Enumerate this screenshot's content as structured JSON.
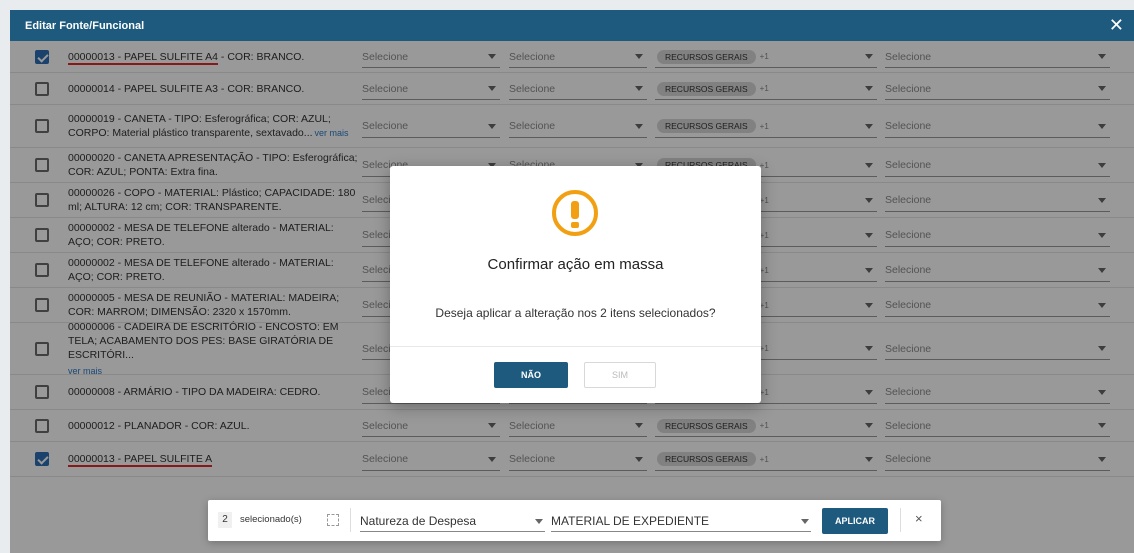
{
  "window": {
    "title": "Editar Fonte/Funcional",
    "close_icon": "close-icon"
  },
  "placeholders": {
    "selecione": "Selecione"
  },
  "chip": {
    "label": "RECURSOS GERAIS",
    "extra": "+1"
  },
  "rows": [
    {
      "desc_code": "00000013 - PAPEL SULFITE A4",
      "desc_rest": " - COR: BRANCO.",
      "checked": true,
      "underline": true
    },
    {
      "desc_code": "",
      "desc_rest": "00000014 - PAPEL SULFITE A3 - COR: BRANCO.",
      "checked": false
    },
    {
      "desc_code": "",
      "desc_rest": "00000019 - CANETA - TIPO: Esferográfica; COR: AZUL; CORPO: Material plástico transparente, sextavado...",
      "ver_mais": "ver mais",
      "checked": false
    },
    {
      "desc_code": "",
      "desc_rest": "00000020 - CANETA APRESENTAÇÃO - TIPO: Esferográfica; COR: AZUL; PONTA: Extra fina.",
      "checked": false
    },
    {
      "desc_code": "",
      "desc_rest": "00000026 - COPO - MATERIAL: Plástico; CAPACIDADE: 180 ml; ALTURA: 12 cm; COR: TRANSPARENTE.",
      "checked": false
    },
    {
      "desc_code": "",
      "desc_rest": "00000002 - MESA DE TELEFONE alterado - MATERIAL: AÇO; COR: PRETO.",
      "checked": false
    },
    {
      "desc_code": "",
      "desc_rest": "00000002 - MESA DE TELEFONE alterado - MATERIAL: AÇO; COR: PRETO.",
      "checked": false
    },
    {
      "desc_code": "",
      "desc_rest": "00000005 - MESA DE REUNIÃO - MATERIAL: MADEIRA; COR: MARROM; DIMENSÃO: 2320 x 1570mm.",
      "checked": false
    },
    {
      "desc_code": "",
      "desc_rest": "00000006 - CADEIRA DE ESCRITÓRIO - ENCOSTO: EM TELA; ACABAMENTO DOS PES: BASE GIRATÓRIA DE ESCRITÓRI...",
      "ver_mais": "ver mais",
      "checked": false
    },
    {
      "desc_code": "",
      "desc_rest": "00000008 - ARMÁRIO - TIPO DA MADEIRA: CEDRO.",
      "checked": false
    },
    {
      "desc_code": "",
      "desc_rest": "00000012 - PLANADOR - COR: AZUL.",
      "checked": false
    },
    {
      "desc_code": "00000013 - PAPEL SULFITE A",
      "desc_rest": "",
      "checked": true,
      "underline": true
    }
  ],
  "modal": {
    "title": "Confirmar ação em massa",
    "message": "Deseja aplicar a alteração nos 2 itens selecionados?",
    "no_label": "NÃO",
    "yes_label": "SIM",
    "icon": "warning-icon"
  },
  "bulkbar": {
    "count": "2",
    "selected_label": "selecionado(s)",
    "field1": "Natureza de Despesa",
    "field2": "MATERIAL DE EXPEDIENTE",
    "apply_label": "APLICAR",
    "close_glyph": "×"
  },
  "colors": {
    "header": "#1d5a7e",
    "accent": "#2d6eb4",
    "warning": "#f2a013",
    "underline": "#e12b2b"
  }
}
